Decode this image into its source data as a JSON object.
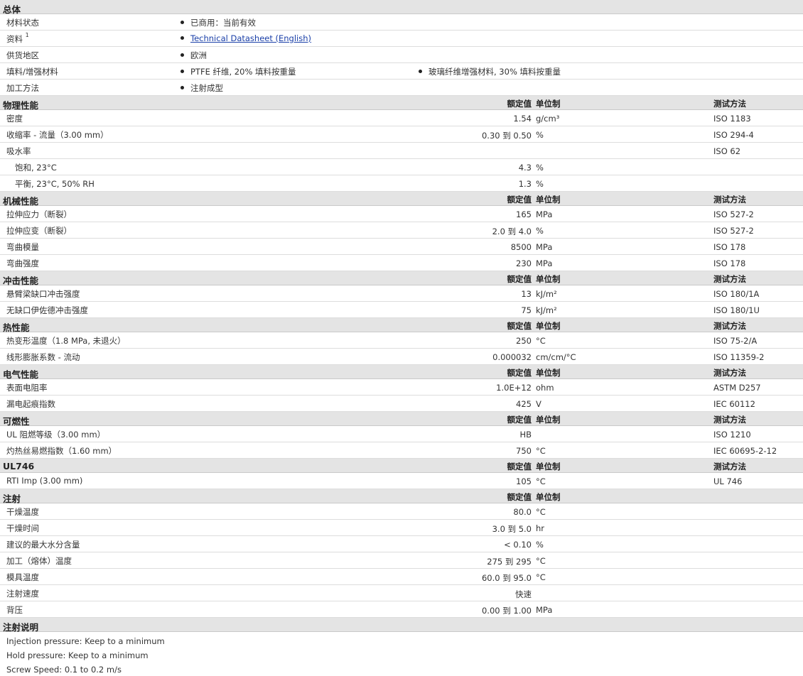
{
  "general": {
    "title": "总体",
    "rows": [
      {
        "label": "材料状态",
        "items": [
          "已商用：当前有效"
        ]
      },
      {
        "label": "资料",
        "sup": "1",
        "link": "Technical Datasheet (English)"
      },
      {
        "label": "供货地区",
        "items": [
          "欧洲"
        ]
      },
      {
        "label": "填料/增强材料",
        "items": [
          "PTFE 纤维, 20% 填料按重量",
          "玻璃纤维增强材料, 30% 填料按重量"
        ]
      },
      {
        "label": "加工方法",
        "items": [
          "注射成型"
        ]
      }
    ]
  },
  "columns": {
    "nominal": "额定值",
    "unit": "单位制",
    "test": "测试方法"
  },
  "sections": [
    {
      "title": "物理性能",
      "show_test": true,
      "rows": [
        {
          "label": "密度",
          "value": "1.54",
          "unit": "g/cm³",
          "test": "ISO 1183"
        },
        {
          "label": "收缩率 - 流量（3.00 mm）",
          "value": "0.30 到  0.50",
          "unit": "%",
          "test": "ISO 294-4"
        },
        {
          "label": "吸水率",
          "value": "",
          "unit": "",
          "test": "ISO 62"
        },
        {
          "label": "饱和, 23°C",
          "sub": true,
          "value": "4.3",
          "unit": "%",
          "test": ""
        },
        {
          "label": "平衡, 23°C, 50% RH",
          "sub": true,
          "value": "1.3",
          "unit": "%",
          "test": ""
        }
      ]
    },
    {
      "title": "机械性能",
      "show_test": true,
      "rows": [
        {
          "label": "拉伸应力（断裂）",
          "value": "165",
          "unit": "MPa",
          "test": "ISO 527-2"
        },
        {
          "label": "拉伸应变（断裂）",
          "value": "2.0 到  4.0",
          "unit": "%",
          "test": "ISO 527-2"
        },
        {
          "label": "弯曲模量",
          "value": "8500",
          "unit": "MPa",
          "test": "ISO 178"
        },
        {
          "label": "弯曲强度",
          "value": "230",
          "unit": "MPa",
          "test": "ISO 178"
        }
      ]
    },
    {
      "title": "冲击性能",
      "show_test": true,
      "rows": [
        {
          "label": "悬臂梁缺口冲击强度",
          "value": "13",
          "unit": "kJ/m²",
          "test": "ISO 180/1A"
        },
        {
          "label": "无缺口伊佐德冲击强度",
          "value": "75",
          "unit": "kJ/m²",
          "test": "ISO 180/1U"
        }
      ]
    },
    {
      "title": "热性能",
      "show_test": true,
      "rows": [
        {
          "label": "热变形温度（1.8 MPa, 未退火）",
          "value": "250",
          "unit": "°C",
          "test": "ISO 75-2/A"
        },
        {
          "label": "线形膨胀系数 - 流动",
          "value": "0.000032",
          "unit": "cm/cm/°C",
          "test": "ISO 11359-2"
        }
      ]
    },
    {
      "title": "电气性能",
      "show_test": true,
      "rows": [
        {
          "label": "表面电阻率",
          "value": "1.0E+12",
          "unit": "ohm",
          "test": "ASTM D257"
        },
        {
          "label": "漏电起痕指数",
          "value": "425",
          "unit": "V",
          "test": "IEC 60112"
        }
      ]
    },
    {
      "title": "可燃性",
      "show_test": true,
      "rows": [
        {
          "label": "UL 阻燃等级（3.00 mm）",
          "value": "HB",
          "unit": "",
          "test": "ISO 1210"
        },
        {
          "label": "灼热丝易燃指数（1.60 mm）",
          "value": "750",
          "unit": "°C",
          "test": "IEC 60695-2-12"
        }
      ]
    },
    {
      "title": "UL746",
      "show_test": true,
      "rows": [
        {
          "label": "RTI Imp (3.00 mm)",
          "value": "105",
          "unit": "°C",
          "test": "UL 746"
        }
      ]
    },
    {
      "title": "注射",
      "show_test": false,
      "rows": [
        {
          "label": "干燥温度",
          "value": "80.0",
          "unit": "°C",
          "test": ""
        },
        {
          "label": "干燥时间",
          "value": "3.0 到  5.0",
          "unit": "hr",
          "test": ""
        },
        {
          "label": "建议的最大水分含量",
          "value": "< 0.10",
          "unit": "%",
          "test": ""
        },
        {
          "label": "加工（熔体）温度",
          "value": "275 到  295",
          "unit": "°C",
          "test": ""
        },
        {
          "label": "模具温度",
          "value": "60.0 到  95.0",
          "unit": "°C",
          "test": ""
        },
        {
          "label": "注射速度",
          "value": "快速",
          "unit": "",
          "test": ""
        },
        {
          "label": "背压",
          "value": "0.00 到  1.00",
          "unit": "MPa",
          "test": ""
        }
      ]
    }
  ],
  "notes": {
    "title": "注射说明",
    "lines": [
      "Injection pressure: Keep to a minimum",
      "Hold pressure: Keep to a minimum",
      "Screw Speed: 0.1 to 0.2 m/s"
    ]
  }
}
